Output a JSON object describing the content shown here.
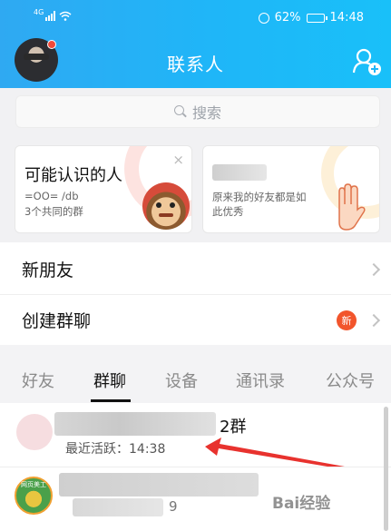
{
  "status_bar": {
    "network": "4G",
    "battery": "62%",
    "battery_level": 0.62,
    "time": "14:48"
  },
  "header": {
    "title": "联系人",
    "add_icon": "add-contact-icon"
  },
  "search": {
    "placeholder": "搜索"
  },
  "recommend_cards": [
    {
      "title": "可能认识的人",
      "line1": "=OO= /db",
      "line2": "3个共同的群",
      "close": "×"
    },
    {
      "title": "",
      "line1": "原来我的好友都是如",
      "line2": "此优秀"
    }
  ],
  "list": {
    "new_friends": "新朋友",
    "create_group": "创建群聊",
    "create_group_badge": "新"
  },
  "tabs": [
    "好友",
    "群聊",
    "设备",
    "通讯录",
    "公众号"
  ],
  "active_tab": 1,
  "groups": [
    {
      "name_suffix": "2群",
      "active_text": "最近活跃：14:38"
    },
    {
      "name_suffix": "9",
      "avatar_text": "网页美工"
    }
  ],
  "watermark": "Bai经验",
  "colors": {
    "header_blue": "#1fb6f8",
    "badge_red": "#f2552c",
    "arrow_red": "#e8322e"
  }
}
